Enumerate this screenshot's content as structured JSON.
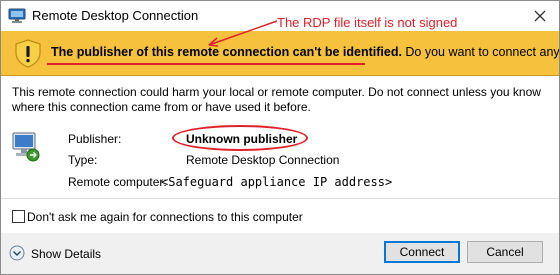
{
  "window": {
    "title": "Remote Desktop Connection",
    "icons": {
      "app": "rdp-app-icon",
      "close": "close-icon"
    }
  },
  "banner": {
    "question_bold": "The publisher of this remote connection can't be identified.",
    "question_rest": " Do you want to connect anyway?",
    "background": "#f6c13d",
    "icon": "warning-shield-icon"
  },
  "annotation": {
    "text": "The RDP file itself is not signed",
    "color": "#e0202a"
  },
  "description": "This remote connection could harm your local or remote computer. Do not connect unless you know where this connection came from or have used it before.",
  "details": {
    "icon": "remote-computer-icon",
    "publisher_label": "Publisher:",
    "publisher_value": "Unknown publisher",
    "type_label": "Type:",
    "type_value": "Remote Desktop Connection",
    "remote_label": "Remote computer:",
    "remote_value": "<Safeguard appliance IP address>"
  },
  "checkbox": {
    "label": "Don't ask me again for connections to this computer",
    "checked": false
  },
  "footer": {
    "show_details": "Show Details",
    "show_details_icon": "chevron-down-circle-icon",
    "connect": "Connect",
    "cancel": "Cancel"
  }
}
